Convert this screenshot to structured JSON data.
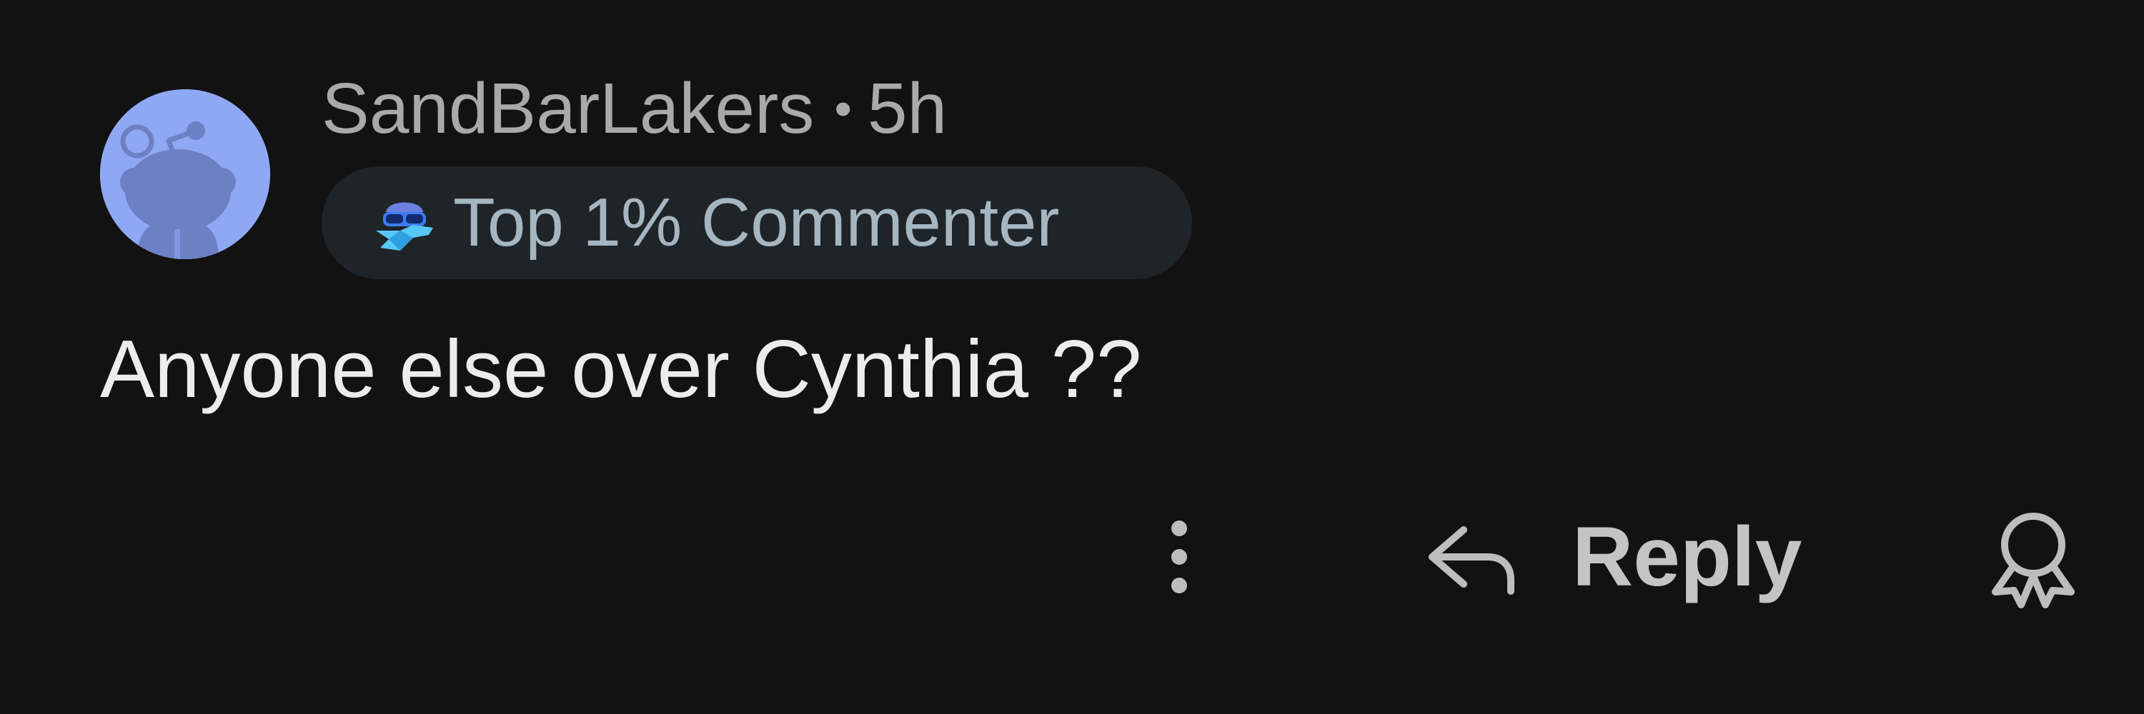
{
  "comment": {
    "username": "SandBarLakers",
    "separator": "•",
    "timestamp": "5h",
    "flair": {
      "icon": "snoo-sunglasses-icon",
      "label": "Top 1% Commenter"
    },
    "body": "Anyone else over Cynthia ??",
    "avatar_color": "#8fa8f4"
  },
  "actions": {
    "more_icon": "more-vertical-icon",
    "reply_icon": "reply-arrow-icon",
    "reply_label": "Reply",
    "award_icon": "award-icon"
  },
  "colors": {
    "background": "#121212",
    "flair_background": "#1f2429",
    "muted_text": "#a9a9a9",
    "body_text": "#ececec"
  }
}
